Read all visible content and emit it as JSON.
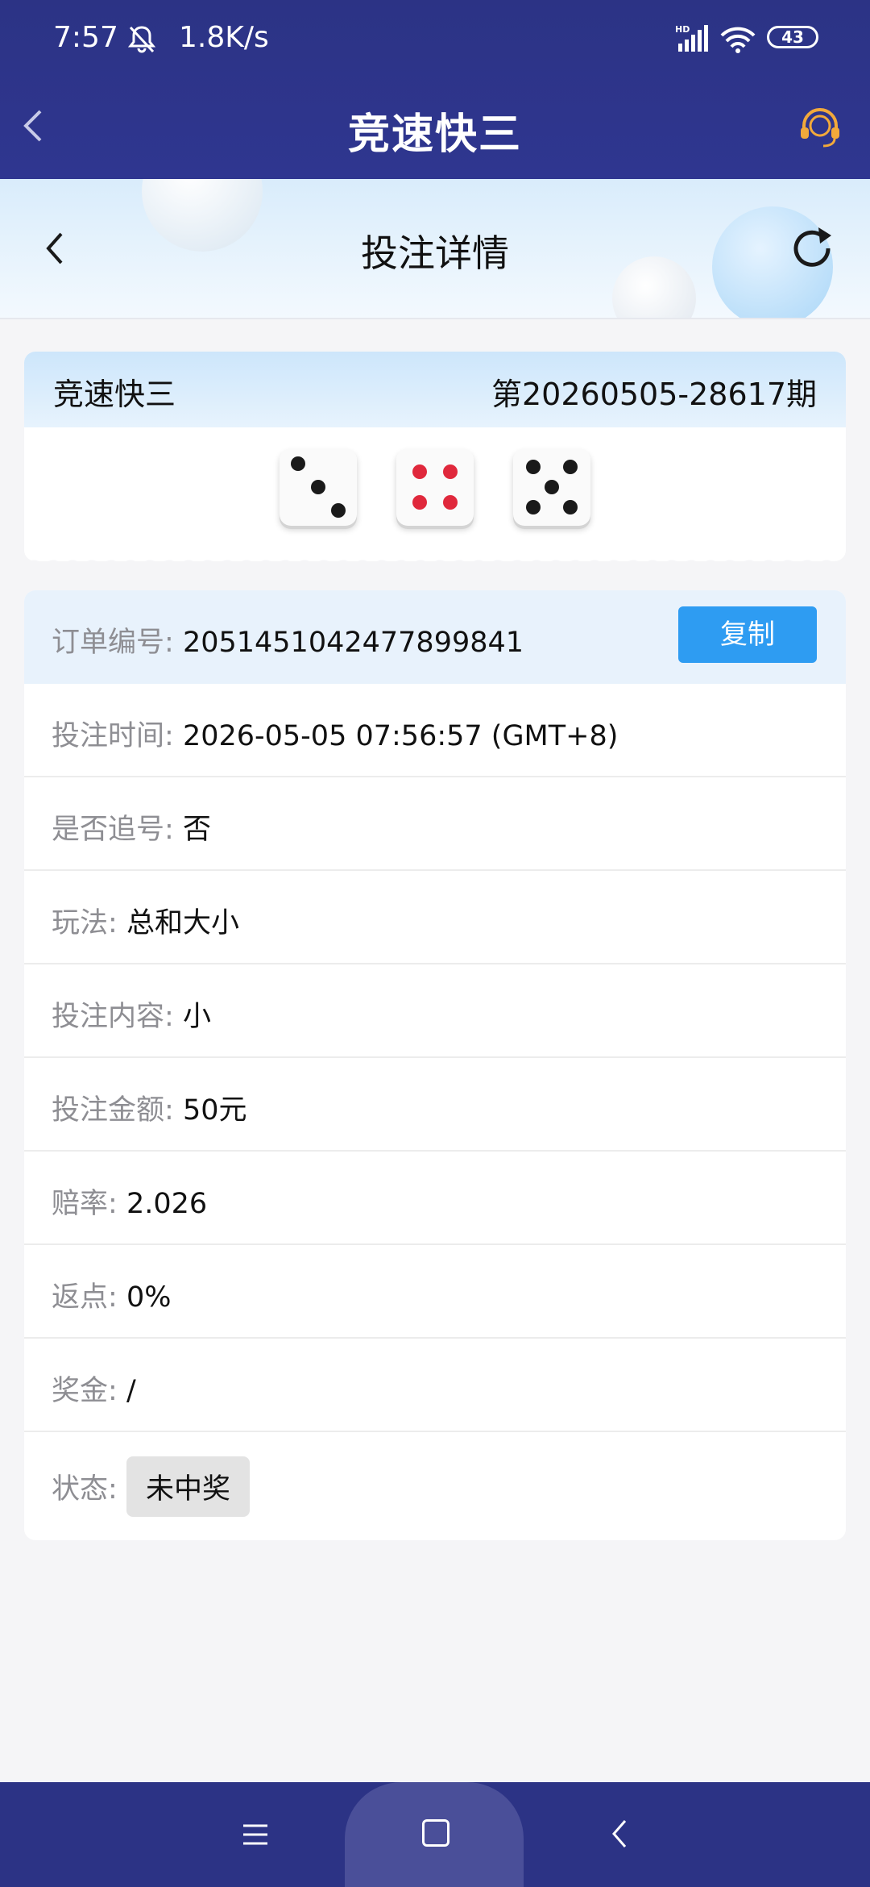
{
  "status_bar": {
    "time": "7:57",
    "speed": "1.8K/s",
    "signal_label": "HD",
    "battery": "43",
    "icons": [
      "bell-muted-icon",
      "signal-icon",
      "wifi-icon",
      "battery-icon"
    ]
  },
  "header": {
    "title": "竞速快三",
    "icons": [
      "back-chevron-icon",
      "headset-support-icon"
    ]
  },
  "sub_header": {
    "title": "投注详情",
    "icons": [
      "back-chevron-icon",
      "refresh-icon"
    ]
  },
  "result": {
    "game_name": "竞速快三",
    "issue": "第20260505-28617期",
    "dice": [
      3,
      4,
      5
    ],
    "dice_colors": {
      "default": "#1a1a1a",
      "four": "#e0283c"
    }
  },
  "details": {
    "order_no": {
      "label": "订单编号:",
      "value": "2051451042477899841",
      "copy_label": "复制"
    },
    "bet_time": {
      "label": "投注时间:",
      "value": "2026-05-05 07:56:57 (GMT+8)"
    },
    "chase": {
      "label": "是否追号:",
      "value": "否"
    },
    "play": {
      "label": "玩法:",
      "value": "总和大小"
    },
    "content": {
      "label": "投注内容:",
      "value": "小"
    },
    "amount": {
      "label": "投注金额:",
      "value": "50元"
    },
    "odds": {
      "label": "赔率:",
      "value": "2.026"
    },
    "rebate": {
      "label": "返点:",
      "value": "0%"
    },
    "prize": {
      "label": "奖金:",
      "value": "/"
    },
    "state": {
      "label": "状态:",
      "value": "未中奖"
    }
  },
  "colors": {
    "header_bg": "#2c3385",
    "accent": "#2e9cf2",
    "label_gray": "#8e8e93"
  },
  "bottom_nav": {
    "icons": [
      "menu-icon",
      "home-icon",
      "back-icon"
    ]
  }
}
